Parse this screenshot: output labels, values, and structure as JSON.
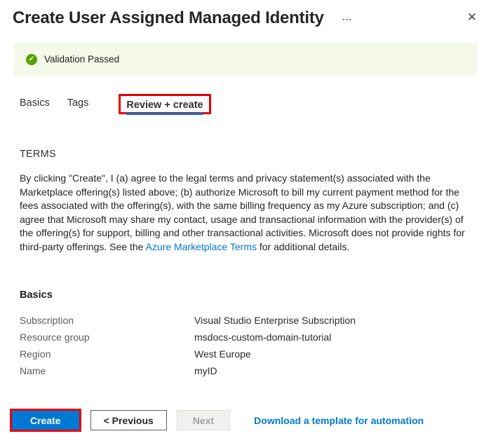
{
  "header": {
    "title": "Create User Assigned Managed Identity",
    "ellipsis_glyph": "...",
    "close_glyph": "✕"
  },
  "banner": {
    "check_glyph": "✓",
    "text": "Validation Passed"
  },
  "tabs": [
    {
      "label": "Basics",
      "active": false
    },
    {
      "label": "Tags",
      "active": false
    },
    {
      "label": "Review + create",
      "active": true
    }
  ],
  "terms": {
    "heading": "TERMS",
    "body_before_link": "By clicking \"Create\", I (a) agree to the legal terms and privacy statement(s) associated with the Marketplace offering(s) listed above; (b) authorize Microsoft to bill my current payment method for the fees associated with the offering(s), with the same billing frequency as my Azure subscription; and (c) agree that Microsoft may share my contact, usage and transactional information with the provider(s) of the offering(s) for support, billing and other transactional activities. Microsoft does not provide rights for third-party offerings. See the ",
    "link_text": "Azure Marketplace Terms",
    "body_after_link": " for additional details."
  },
  "review": {
    "heading": "Basics",
    "rows": [
      {
        "label": "Subscription",
        "value": "Visual Studio Enterprise Subscription"
      },
      {
        "label": "Resource group",
        "value": "msdocs-custom-domain-tutorial"
      },
      {
        "label": "Region",
        "value": "West Europe"
      },
      {
        "label": "Name",
        "value": "myID"
      }
    ]
  },
  "footer": {
    "create_label": "Create",
    "previous_label": "< Previous",
    "next_label": "Next",
    "download_link_label": "Download a template for automation"
  },
  "colors": {
    "accent_blue": "#0078d4",
    "success_green": "#57a300",
    "banner_background": "#f4f9e9",
    "annotation_red": "#e60000"
  }
}
